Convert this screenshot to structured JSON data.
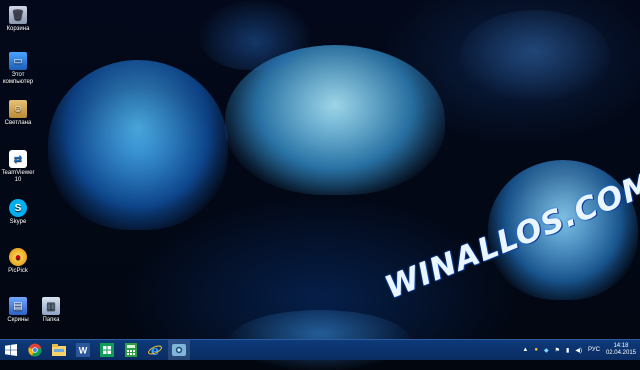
{
  "desktop": {
    "icons": [
      {
        "label": "Корзина",
        "icon": "recycle-bin-icon"
      },
      {
        "label": "Этот компьютер",
        "icon": "computer-icon"
      },
      {
        "label": "Светлана",
        "icon": "user-folder-icon"
      },
      {
        "label": "TeamViewer 10",
        "icon": "teamviewer-icon"
      },
      {
        "label": "Skype",
        "icon": "skype-icon"
      },
      {
        "label": "PicPick",
        "icon": "picpick-icon"
      },
      {
        "label": "Скрины",
        "icon": "folder-icon"
      },
      {
        "label": "Папка",
        "icon": "folder-icon"
      }
    ],
    "watermark": "WINALLOS.COM"
  },
  "taskbar": {
    "buttons": [
      {
        "name": "start",
        "icon": "windows-logo-icon"
      },
      {
        "name": "chrome",
        "icon": "chrome-icon"
      },
      {
        "name": "explorer",
        "icon": "file-explorer-icon"
      },
      {
        "name": "word",
        "icon": "word-icon"
      },
      {
        "name": "store",
        "icon": "store-icon"
      },
      {
        "name": "calculator",
        "icon": "calculator-icon"
      },
      {
        "name": "internet-explorer",
        "icon": "ie-icon"
      },
      {
        "name": "screenshot-tool",
        "icon": "screenshot-tool-icon"
      }
    ],
    "tray": {
      "language": "РУС",
      "time": "14:18",
      "date": "02.04.2015"
    }
  },
  "colors": {
    "taskbar": "#0a2c62",
    "accent": "#1a6cff"
  }
}
